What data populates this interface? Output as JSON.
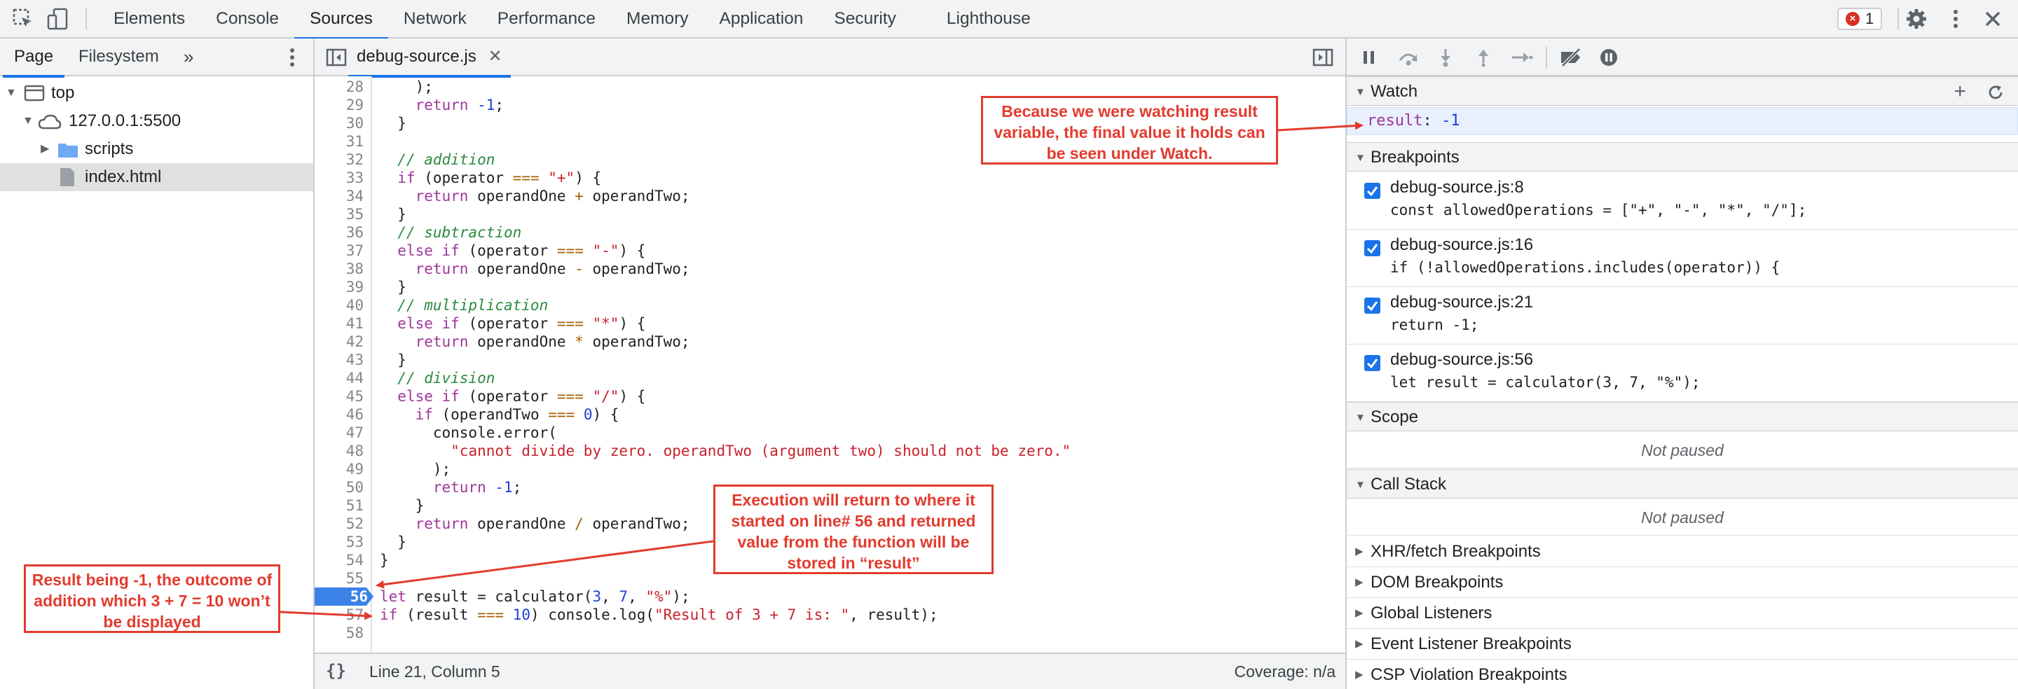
{
  "toolbar": {
    "tabs": [
      "Elements",
      "Console",
      "Sources",
      "Network",
      "Performance",
      "Memory",
      "Application",
      "Security",
      "Lighthouse"
    ],
    "active_tab": "Sources",
    "error_count": "1"
  },
  "navigator": {
    "tabs": [
      "Page",
      "Filesystem"
    ],
    "tree": {
      "top": "top",
      "host": "127.0.0.1:5500",
      "folder": "scripts",
      "file": "index.html"
    }
  },
  "editor": {
    "file_tab": "debug-source.js",
    "lines": [
      {
        "n": "28",
        "code": "    );"
      },
      {
        "n": "29",
        "code": "    return -1;"
      },
      {
        "n": "30",
        "code": "  }"
      },
      {
        "n": "31",
        "code": ""
      },
      {
        "n": "32",
        "code": "  // addition"
      },
      {
        "n": "33",
        "code": "  if (operator === \"+\") {"
      },
      {
        "n": "34",
        "code": "    return operandOne + operandTwo;"
      },
      {
        "n": "35",
        "code": "  }"
      },
      {
        "n": "36",
        "code": "  // subtraction"
      },
      {
        "n": "37",
        "code": "  else if (operator === \"-\") {"
      },
      {
        "n": "38",
        "code": "    return operandOne - operandTwo;"
      },
      {
        "n": "39",
        "code": "  }"
      },
      {
        "n": "40",
        "code": "  // multiplication"
      },
      {
        "n": "41",
        "code": "  else if (operator === \"*\") {"
      },
      {
        "n": "42",
        "code": "    return operandOne * operandTwo;"
      },
      {
        "n": "43",
        "code": "  }"
      },
      {
        "n": "44",
        "code": "  // division"
      },
      {
        "n": "45",
        "code": "  else if (operator === \"/\") {"
      },
      {
        "n": "46",
        "code": "    if (operandTwo === 0) {"
      },
      {
        "n": "47",
        "code": "      console.error("
      },
      {
        "n": "48",
        "code": "        \"cannot divide by zero. operandTwo (argument two) should not be zero.\""
      },
      {
        "n": "49",
        "code": "      );"
      },
      {
        "n": "50",
        "code": "      return -1;"
      },
      {
        "n": "51",
        "code": "    }"
      },
      {
        "n": "52",
        "code": "    return operandOne / operandTwo;"
      },
      {
        "n": "53",
        "code": "  }"
      },
      {
        "n": "54",
        "code": "}"
      },
      {
        "n": "55",
        "code": ""
      },
      {
        "n": "56",
        "code": "let result = calculator(3, 7, \"%\");"
      },
      {
        "n": "57",
        "code": "if (result === 10) console.log(\"Result of 3 + 7 is: \", result);"
      },
      {
        "n": "58",
        "code": ""
      }
    ],
    "breakpoint_line": "56",
    "status": {
      "cursor": "Line 21, Column 5",
      "coverage": "Coverage: n/a"
    }
  },
  "debugger": {
    "watch": {
      "title": "Watch",
      "expression": "result",
      "value": "-1"
    },
    "breakpoints": {
      "title": "Breakpoints",
      "items": [
        {
          "file": "debug-source.js:8",
          "code": "const allowedOperations = [\"+\", \"-\", \"*\", \"/\"];"
        },
        {
          "file": "debug-source.js:16",
          "code": "if (!allowedOperations.includes(operator)) {"
        },
        {
          "file": "debug-source.js:21",
          "code": "return -1;"
        },
        {
          "file": "debug-source.js:56",
          "code": "let result = calculator(3, 7, \"%\");"
        }
      ]
    },
    "scope": {
      "title": "Scope",
      "status": "Not paused"
    },
    "call_stack": {
      "title": "Call Stack",
      "status": "Not paused"
    },
    "collapsed_sections": [
      "XHR/fetch Breakpoints",
      "DOM Breakpoints",
      "Global Listeners",
      "Event Listener Breakpoints",
      "CSP Violation Breakpoints"
    ]
  },
  "annotations": {
    "watch_note": "Because we were watching result variable, the final value it holds can be seen under Watch.",
    "return_note": "Execution will return to where it started on line# 56 and returned value from the function will be stored in “result”",
    "result_note": "Result being -1, the outcome of addition which 3 + 7 = 10 won’t be displayed"
  },
  "colors": {
    "accent": "#1a73e8",
    "annotation": "#e23b2e",
    "breakpoint": "#3b82e6"
  }
}
